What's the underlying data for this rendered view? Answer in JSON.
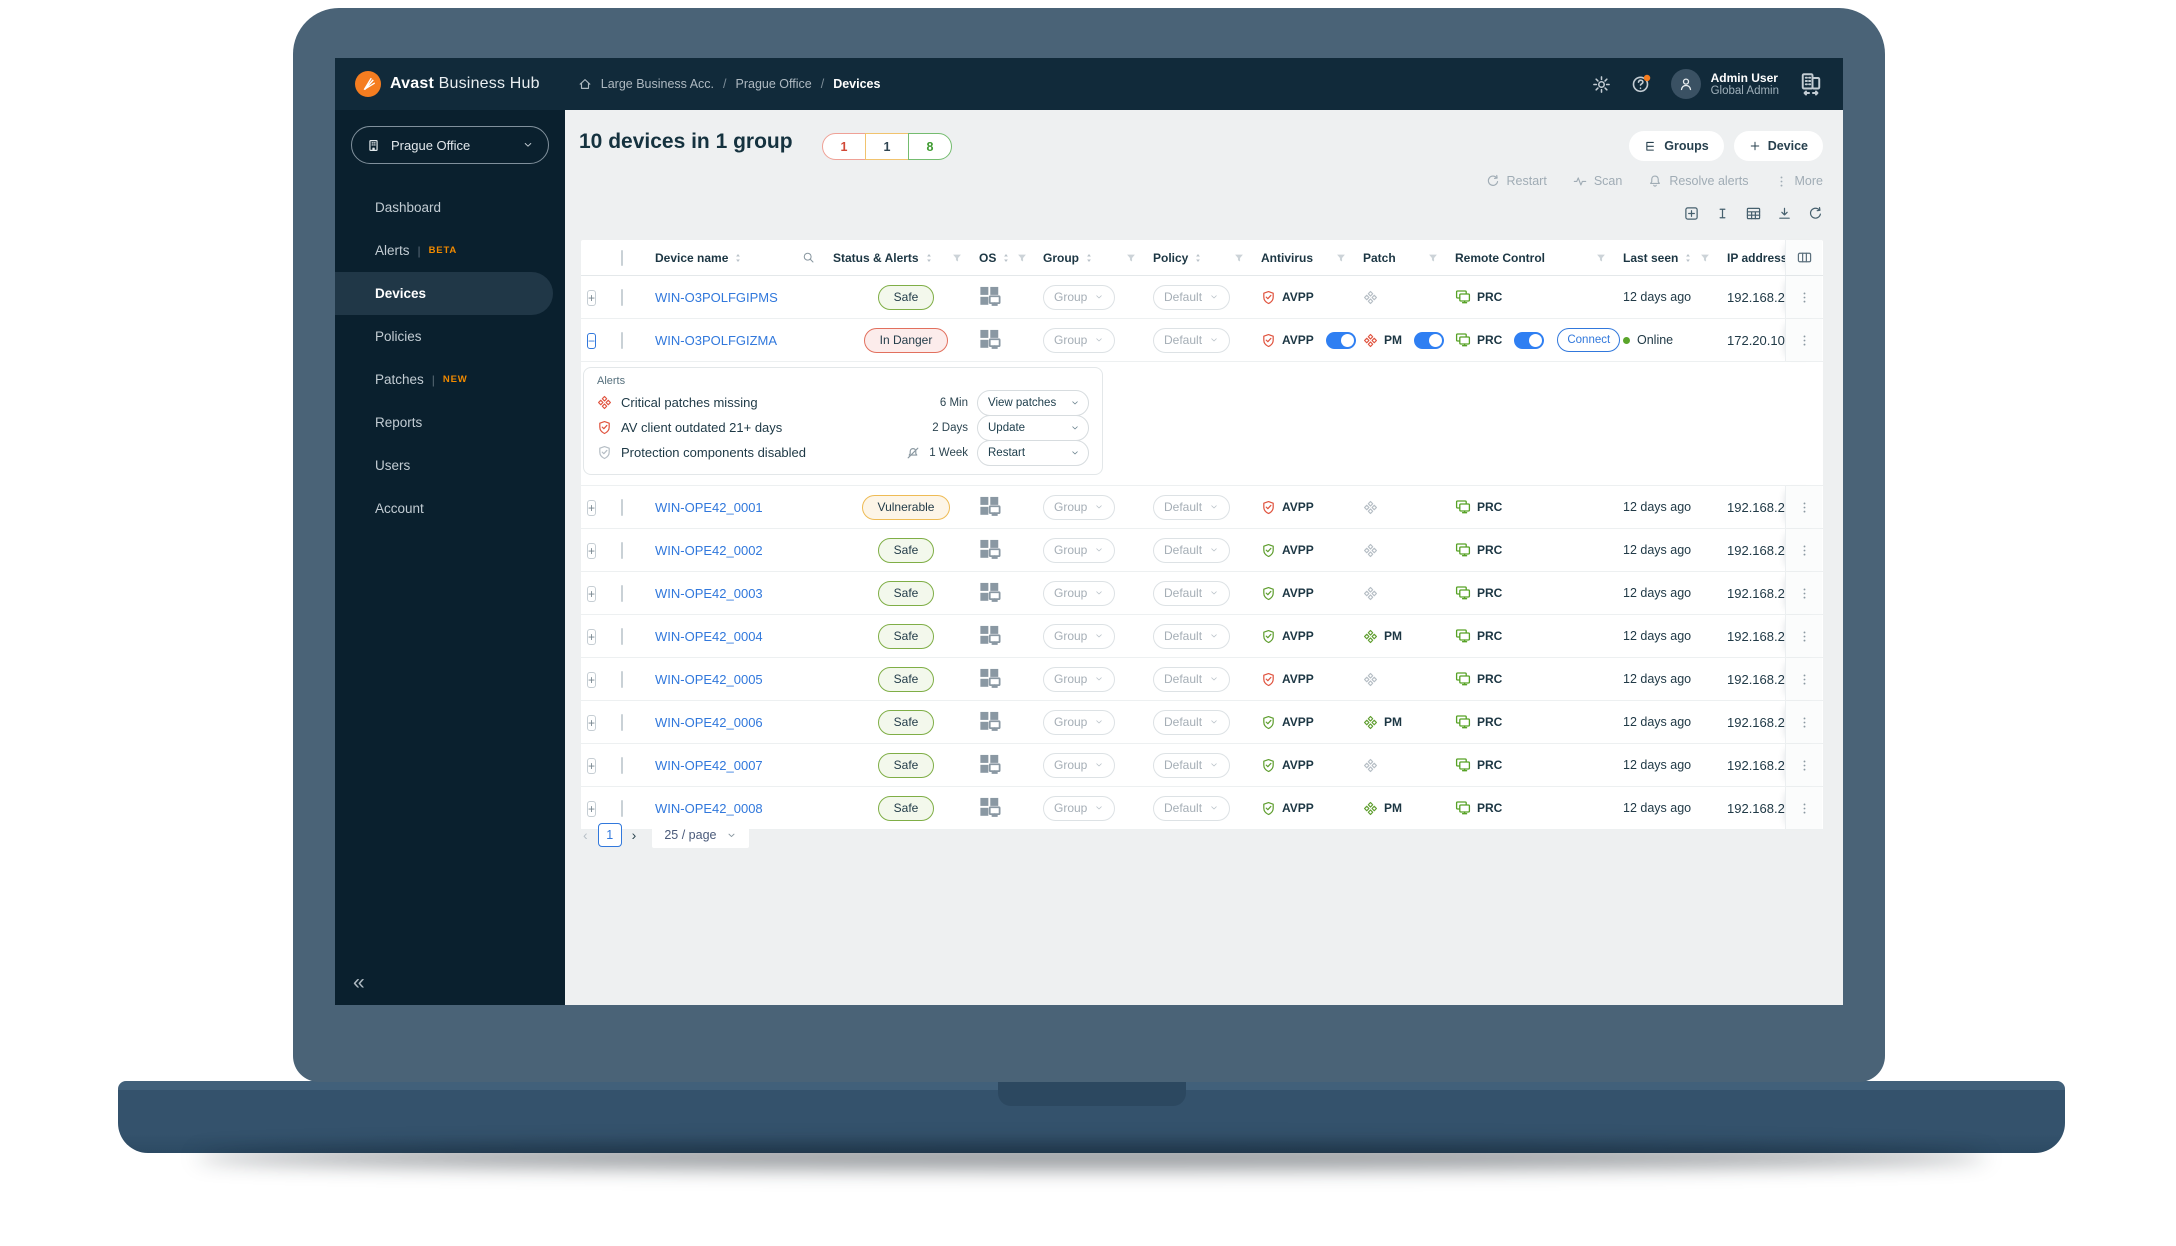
{
  "header": {
    "logo": {
      "bold": "Avast",
      "rest": "Business Hub"
    },
    "breadcrumb": [
      "Large Business Acc.",
      "Prague Office",
      "Devices"
    ],
    "user": {
      "name": "Admin User",
      "role": "Global Admin"
    }
  },
  "sidebar": {
    "company": "Prague Office",
    "items": [
      {
        "label": "Dashboard",
        "icon": "home"
      },
      {
        "label": "Alerts",
        "icon": "bell",
        "badge": "BETA"
      },
      {
        "label": "Devices",
        "icon": "monitor",
        "active": true
      },
      {
        "label": "Policies",
        "icon": "policies"
      },
      {
        "label": "Patches",
        "icon": "patch",
        "badge": "NEW"
      },
      {
        "label": "Reports",
        "icon": "pie"
      },
      {
        "label": "Users",
        "icon": "user"
      },
      {
        "label": "Account",
        "icon": "account"
      }
    ],
    "collapse": "«"
  },
  "main": {
    "title": "10 devices in 1 group",
    "counts": [
      {
        "value": "1",
        "type": "danger"
      },
      {
        "value": "1",
        "type": "warning"
      },
      {
        "value": "8",
        "type": "safe"
      }
    ],
    "actions": {
      "groups": "Groups",
      "device": "Device"
    },
    "toolbar": {
      "restart": "Restart",
      "scan": "Scan",
      "resolve": "Resolve alerts",
      "more": "More"
    },
    "table": {
      "columns": [
        {
          "label": "Device name"
        },
        {
          "label": "Status & Alerts"
        },
        {
          "label": "OS"
        },
        {
          "label": "Group"
        },
        {
          "label": "Policy"
        },
        {
          "label": "Antivirus"
        },
        {
          "label": "Patch"
        },
        {
          "label": "Remote Control"
        },
        {
          "label": "Last seen"
        },
        {
          "label": "IP address"
        }
      ],
      "group_placeholder": "Group",
      "policy_placeholder": "Default",
      "av_label": "AVPP",
      "patch_label": "PM",
      "remote_label": "PRC",
      "connect_label": "Connect",
      "online_label": "Online",
      "rows": [
        {
          "name": "WIN-O3POLFGIPMS",
          "status": "Safe",
          "statusType": "safe",
          "av": "red",
          "patch": "gray",
          "seen": "12 days ago",
          "ip": "192.168.2"
        },
        {
          "name": "WIN-O3POLFGIZMA",
          "status": "In Danger",
          "statusType": "danger",
          "av": "red",
          "avToggle": true,
          "patch": "red",
          "patchToggle": true,
          "remoteToggle": true,
          "connect": true,
          "online": true,
          "ip": "172.20.10",
          "expanded": true
        },
        {
          "name": "WIN-OPE42_0001",
          "status": "Vulnerable",
          "statusType": "warning",
          "av": "red",
          "patch": "gray",
          "seen": "12 days ago",
          "ip": "192.168.2"
        },
        {
          "name": "WIN-OPE42_0002",
          "status": "Safe",
          "statusType": "safe",
          "av": "green",
          "patch": "gray",
          "seen": "12 days ago",
          "ip": "192.168.2"
        },
        {
          "name": "WIN-OPE42_0003",
          "status": "Safe",
          "statusType": "safe",
          "av": "green",
          "patch": "gray",
          "seen": "12 days ago",
          "ip": "192.168.2"
        },
        {
          "name": "WIN-OPE42_0004",
          "status": "Safe",
          "statusType": "safe",
          "av": "green",
          "patch": "green",
          "seen": "12 days ago",
          "ip": "192.168.2"
        },
        {
          "name": "WIN-OPE42_0005",
          "status": "Safe",
          "statusType": "safe",
          "av": "red",
          "patch": "gray",
          "seen": "12 days ago",
          "ip": "192.168.2"
        },
        {
          "name": "WIN-OPE42_0006",
          "status": "Safe",
          "statusType": "safe",
          "av": "green",
          "patch": "green",
          "seen": "12 days ago",
          "ip": "192.168.2"
        },
        {
          "name": "WIN-OPE42_0007",
          "status": "Safe",
          "statusType": "safe",
          "av": "green",
          "patch": "gray",
          "seen": "12 days ago",
          "ip": "192.168.2"
        },
        {
          "name": "WIN-OPE42_0008",
          "status": "Safe",
          "statusType": "safe",
          "av": "green",
          "patch": "green",
          "seen": "12 days ago",
          "ip": "192.168.2"
        }
      ]
    },
    "alerts": {
      "title": "Alerts",
      "items": [
        {
          "icon": "patch",
          "color": "p-red",
          "text": "Critical patches missing",
          "age": "6 Min",
          "action": "View patches"
        },
        {
          "icon": "shield",
          "color": "sh-red",
          "text": "AV client outdated 21+ days",
          "age": "2 Days",
          "action": "Update"
        },
        {
          "icon": "shield",
          "color": "p-gray",
          "muted": true,
          "text": "Protection components disabled",
          "age": "1 Week",
          "action": "Restart"
        }
      ]
    },
    "pagination": {
      "prev": "‹",
      "page": "1",
      "next": "›",
      "size": "25 / page"
    }
  }
}
